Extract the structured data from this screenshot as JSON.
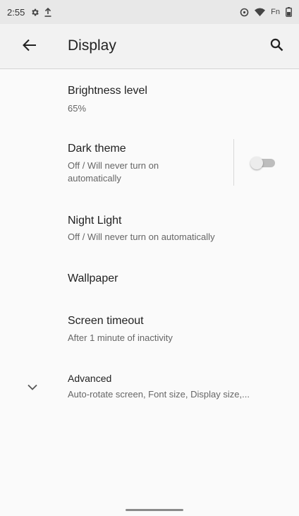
{
  "status_bar": {
    "time": "2:55",
    "fn_label": "Fn",
    "icons": [
      "settings-gear-icon",
      "upload-icon",
      "data-saver-icon",
      "wifi-icon",
      "battery-icon"
    ]
  },
  "toolbar": {
    "title": "Display",
    "back_icon": "arrow-back-icon",
    "search_icon": "search-icon"
  },
  "settings": {
    "brightness": {
      "title": "Brightness level",
      "summary": "65%"
    },
    "dark_theme": {
      "title": "Dark theme",
      "summary": "Off / Will never turn on automatically",
      "enabled": false
    },
    "night_light": {
      "title": "Night Light",
      "summary": "Off / Will never turn on automatically"
    },
    "wallpaper": {
      "title": "Wallpaper"
    },
    "screen_timeout": {
      "title": "Screen timeout",
      "summary": "After 1 minute of inactivity"
    },
    "advanced": {
      "title": "Advanced",
      "summary": "Auto-rotate screen, Font size, Display size,..."
    }
  },
  "colors": {
    "status_bar_bg": "#e8e8e8",
    "toolbar_bg": "#f2f2f2",
    "background": "#fafafa",
    "primary_text": "#222222",
    "secondary_text": "#666666",
    "switch_track_off": "#bdbdbd"
  }
}
